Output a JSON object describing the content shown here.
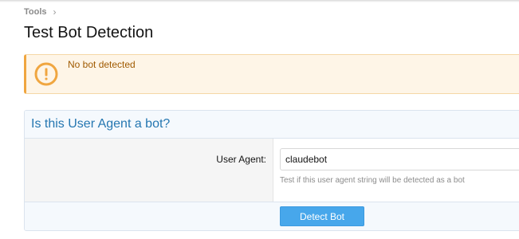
{
  "breadcrumb": {
    "items": [
      "Tools"
    ]
  },
  "page": {
    "title": "Test Bot Detection"
  },
  "notice": {
    "message": "No bot detected",
    "icon": "warning-icon",
    "accent": "#f0a640"
  },
  "form": {
    "heading": "Is this User Agent a bot?",
    "user_agent_label": "User Agent:",
    "user_agent_value": "claudebot",
    "user_agent_hint": "Test if this user agent string will be detected as a bot",
    "submit_label": "Detect Bot"
  }
}
